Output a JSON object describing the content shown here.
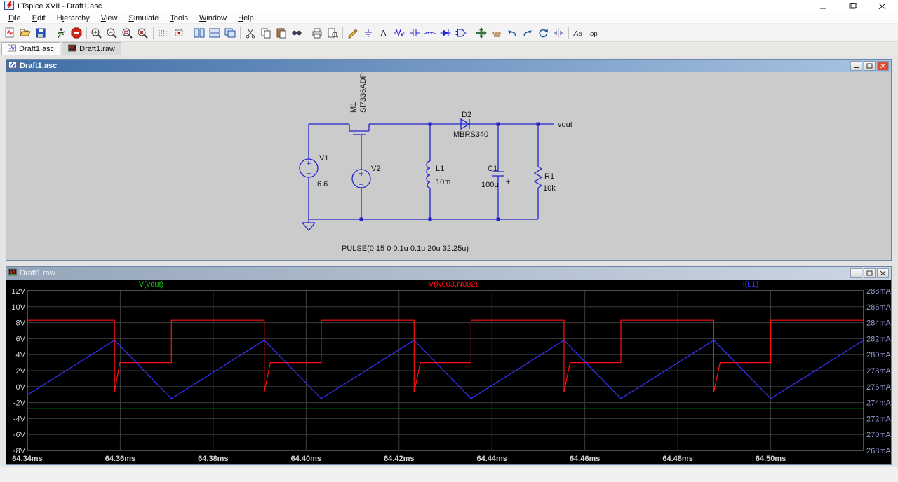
{
  "window": {
    "title": "LTspice XVII - Draft1.asc"
  },
  "menu": {
    "items": [
      {
        "label": "File",
        "accel": 0
      },
      {
        "label": "Edit",
        "accel": 0
      },
      {
        "label": "Hierarchy",
        "accel": 1
      },
      {
        "label": "View",
        "accel": 0
      },
      {
        "label": "Simulate",
        "accel": 0
      },
      {
        "label": "Tools",
        "accel": 0
      },
      {
        "label": "Window",
        "accel": 0
      },
      {
        "label": "Help",
        "accel": 0
      }
    ]
  },
  "toolbar": {
    "items": [
      "new-schematic",
      "open",
      "save",
      "|",
      "run",
      "halt",
      "|",
      "zoom-in",
      "zoom-back",
      "zoom-area",
      "zoom-full",
      "|",
      "grid",
      "mark-unconnected",
      "|",
      "tile-vertical",
      "tile-horizontal",
      "cascade",
      "|",
      "cut",
      "copy",
      "paste",
      "find",
      "|",
      "print",
      "print-preview",
      "|",
      "wire",
      "ground",
      "label-net",
      "resistor",
      "capacitor",
      "inductor",
      "diode",
      "component",
      "|",
      "move",
      "drag",
      "undo",
      "redo",
      "rotate",
      "mirror",
      "|",
      "text",
      "spice-directive"
    ],
    "labels": {
      "text": "Aa",
      "spice_directive": ".op"
    }
  },
  "tabs": [
    {
      "label": "Draft1.asc",
      "active": true
    },
    {
      "label": "Draft1.raw",
      "active": false
    }
  ],
  "schematic": {
    "window_title": "Draft1.asc",
    "wire_color": "#2323cd",
    "background": "#cbcbcb",
    "m1": {
      "name": "M1",
      "model": "Si7336ADP"
    },
    "v1": {
      "name": "V1",
      "value": "6.6"
    },
    "v2": {
      "name": "V2"
    },
    "d2": {
      "name": "D2",
      "model": "MBRS340"
    },
    "l1": {
      "name": "L1",
      "value": "10m"
    },
    "c1": {
      "name": "C1",
      "value": "100µ",
      "polarity": "+"
    },
    "r1": {
      "name": "R1",
      "value": "10k"
    },
    "net_label": "vout",
    "directive": "PULSE(0 15 0 0.1u 0.1u 20u 32.25u)"
  },
  "waveform": {
    "window_title": "Draft1.raw",
    "chart_data": {
      "type": "line",
      "background": "#000000",
      "grid_color": "#3c3c3c",
      "border_color": "#9aa0a6",
      "x_range_ms": [
        64.34,
        64.52
      ],
      "x_ticks": [
        "64.34ms",
        "64.36ms",
        "64.38ms",
        "64.40ms",
        "64.42ms",
        "64.44ms",
        "64.46ms",
        "64.48ms",
        "64.50ms"
      ],
      "x_tick_values": [
        64.34,
        64.36,
        64.38,
        64.4,
        64.42,
        64.44,
        64.46,
        64.48,
        64.5
      ],
      "x_label_color": "#d4d4d4",
      "left_axis": {
        "unit": "V",
        "min": -8,
        "max": 12,
        "color": "#d4d4d4",
        "ticks": [
          "12V",
          "10V",
          "8V",
          "6V",
          "4V",
          "2V",
          "0V",
          "-2V",
          "-4V",
          "-6V",
          "-8V"
        ],
        "tick_values": [
          12,
          10,
          8,
          6,
          4,
          2,
          0,
          -2,
          -4,
          -6,
          -8
        ]
      },
      "right_axis": {
        "unit": "mA",
        "min": 268,
        "max": 288,
        "color": "#979dd2",
        "ticks": [
          "288mA",
          "286mA",
          "284mA",
          "282mA",
          "280mA",
          "278mA",
          "276mA",
          "274mA",
          "272mA",
          "270mA",
          "268mA"
        ],
        "tick_values": [
          288,
          286,
          284,
          282,
          280,
          278,
          276,
          274,
          272,
          270,
          268
        ]
      },
      "series": [
        {
          "name": "V(vout)",
          "color": "#00c800",
          "axis": "left",
          "points": [
            [
              64.34,
              -2.7
            ],
            [
              64.52,
              -2.7
            ]
          ]
        },
        {
          "name": "V(N003,N002)",
          "color": "#ff1010",
          "axis": "left",
          "points": [
            [
              64.34,
              8.3
            ],
            [
              64.35875,
              8.3
            ],
            [
              64.35875,
              -0.7
            ],
            [
              64.3599,
              3.0
            ],
            [
              64.371,
              3.0
            ],
            [
              64.371,
              8.3
            ],
            [
              64.391,
              8.3
            ],
            [
              64.391,
              -0.7
            ],
            [
              64.3923,
              3.0
            ],
            [
              64.40325,
              3.0
            ],
            [
              64.40325,
              8.3
            ],
            [
              64.42325,
              8.3
            ],
            [
              64.42325,
              -0.7
            ],
            [
              64.4246,
              3.0
            ],
            [
              64.4355,
              3.0
            ],
            [
              64.4355,
              8.3
            ],
            [
              64.4555,
              8.3
            ],
            [
              64.4555,
              -0.7
            ],
            [
              64.4568,
              3.0
            ],
            [
              64.46775,
              3.0
            ],
            [
              64.46775,
              8.3
            ],
            [
              64.48775,
              8.3
            ],
            [
              64.48775,
              -0.7
            ],
            [
              64.4891,
              3.0
            ],
            [
              64.5,
              3.0
            ],
            [
              64.5,
              8.3
            ],
            [
              64.52,
              8.3
            ]
          ]
        },
        {
          "name": "I(L1)",
          "color": "#3535ff",
          "axis": "right",
          "points": [
            [
              64.34,
              274.95
            ],
            [
              64.35875,
              281.8
            ],
            [
              64.371,
              274.5
            ],
            [
              64.391,
              281.8
            ],
            [
              64.40325,
              274.5
            ],
            [
              64.42325,
              281.8
            ],
            [
              64.4355,
              274.5
            ],
            [
              64.4555,
              281.8
            ],
            [
              64.46775,
              274.5
            ],
            [
              64.48775,
              281.8
            ],
            [
              64.5,
              274.5
            ],
            [
              64.52,
              281.8
            ]
          ]
        }
      ]
    }
  }
}
